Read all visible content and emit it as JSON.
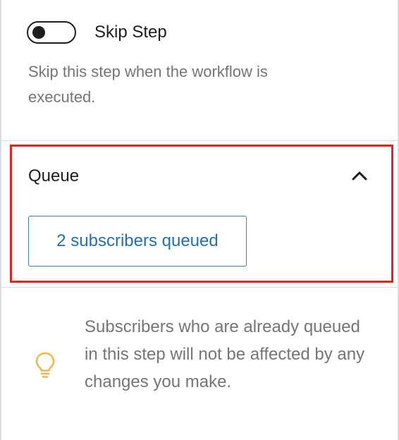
{
  "skip_step": {
    "label": "Skip Step",
    "enabled": false,
    "help": "Skip this step when the workflow is executed."
  },
  "queue": {
    "title": "Queue",
    "expanded": true,
    "button_label": "2 subscribers queued"
  },
  "notice": {
    "text": "Subscribers who are already queued in this step will not be affected by any changes you make.",
    "icon": "lightbulb-icon"
  },
  "colors": {
    "highlight": "#e8231a",
    "link": "#2271b1",
    "muted_text": "#757575",
    "bulb": "#f0b849"
  }
}
